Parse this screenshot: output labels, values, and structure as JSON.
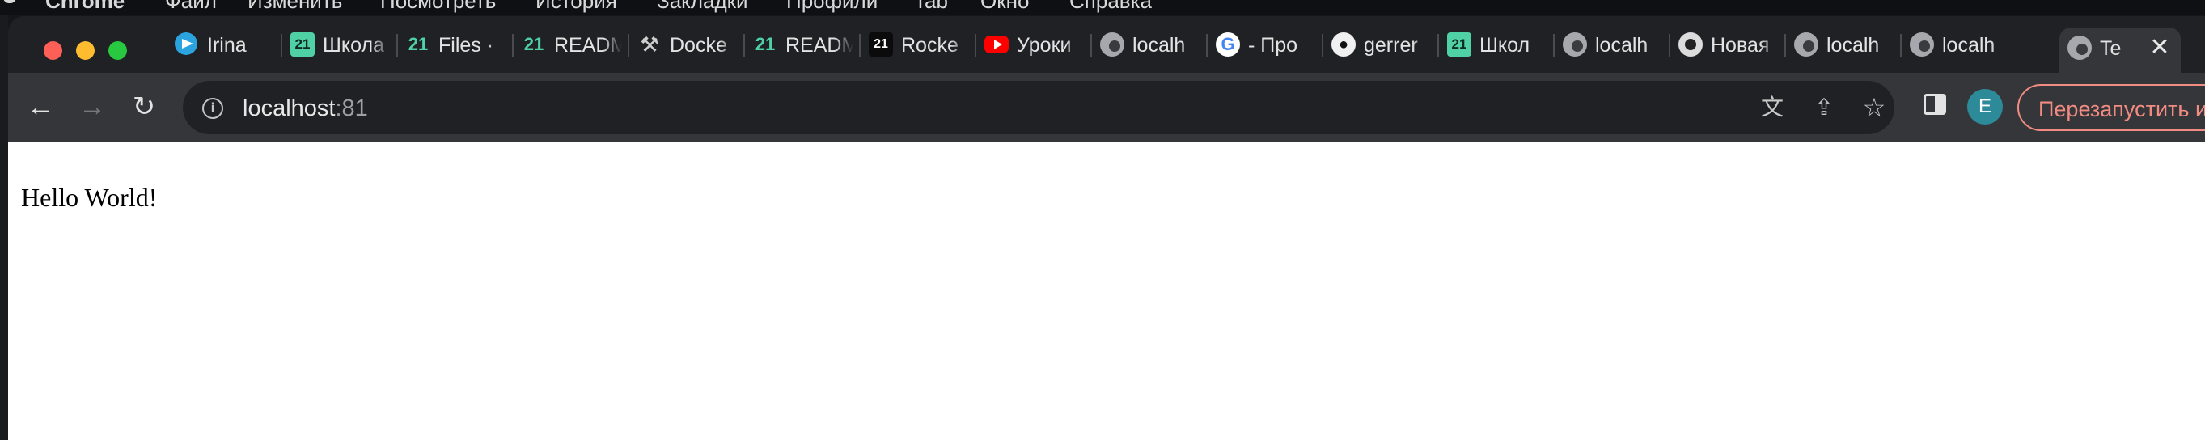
{
  "system_menu": {
    "items": [
      "Chrome",
      "Файл",
      "Изменить",
      "Посмотреть",
      "История",
      "Закладки",
      "Профили",
      "Tab",
      "Окно",
      "Справка"
    ]
  },
  "tabs": [
    {
      "label": "Irina",
      "icon": "telegram-icon"
    },
    {
      "label": "Школа",
      "icon": "school21-icon"
    },
    {
      "label": "Files ·",
      "icon": "school21-icon"
    },
    {
      "label": "READM",
      "icon": "school21-icon"
    },
    {
      "label": "Docke",
      "icon": "tools-icon"
    },
    {
      "label": "READM",
      "icon": "school21-icon"
    },
    {
      "label": "Rocke",
      "icon": "school21-icon"
    },
    {
      "label": "Уроки",
      "icon": "youtube-icon"
    },
    {
      "label": "localh",
      "icon": "globe-icon"
    },
    {
      "label": "- Про",
      "icon": "google-icon"
    },
    {
      "label": "gerrer",
      "icon": "github-icon"
    },
    {
      "label": "Школ",
      "icon": "school21-icon"
    },
    {
      "label": "localh",
      "icon": "globe-icon"
    },
    {
      "label": "Новая",
      "icon": "chrome-icon"
    },
    {
      "label": "localh",
      "icon": "globe-icon"
    },
    {
      "label": "localh",
      "icon": "globe-icon"
    },
    {
      "label": "Te",
      "icon": "globe-icon",
      "active": true
    }
  ],
  "toolbar": {
    "back_icon": "←",
    "forward_icon": "→",
    "reload_icon": "↻",
    "url_host": "localhost",
    "url_port": ":81",
    "avatar_initial": "E",
    "restart_label": "Перезапустить и"
  },
  "page": {
    "text": "Hello World!"
  },
  "colors": {
    "window_bg": "#202124",
    "toolbar_bg": "#35363a",
    "restart_accent": "#f28b82",
    "avatar_bg": "#2d8a99"
  }
}
